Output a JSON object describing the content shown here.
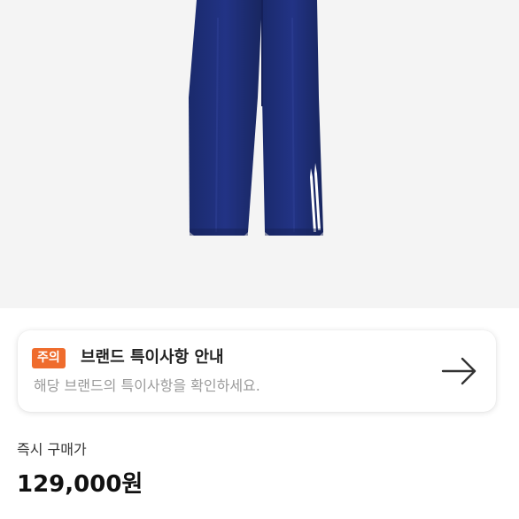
{
  "product": {
    "image_icon": "track-pants-photo",
    "pants_color": "#1f2f78",
    "stripe_color": "#ffffff"
  },
  "notice": {
    "badge": "주의",
    "title": "브랜드 특이사항 안내",
    "description": "해당 브랜드의 특이사항을 확인하세요.",
    "arrow_icon": "arrow-right-icon",
    "badge_color": "#ef6c2d"
  },
  "price": {
    "label": "즉시 구매가",
    "value": "129,000원"
  }
}
